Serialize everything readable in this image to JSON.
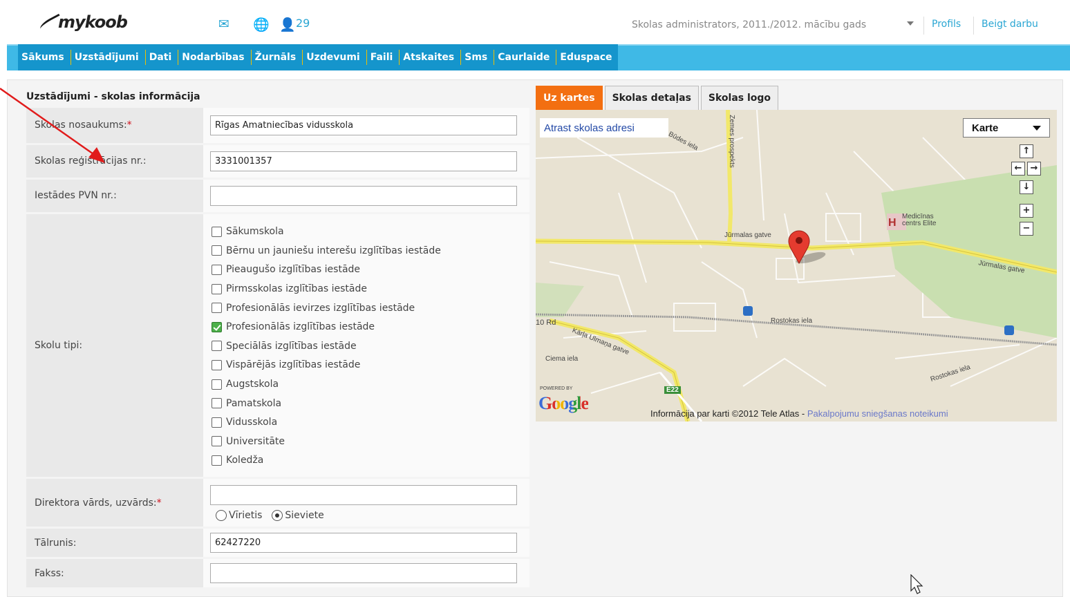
{
  "header": {
    "logo_text": "mykoob",
    "users_count": "29",
    "user_role": "Skolas administrators, 2011./2012. mācību gads",
    "profile_link": "Profils",
    "logout_link": "Beigt darbu"
  },
  "nav": {
    "items": [
      "Sākums",
      "Uzstādījumi",
      "Dati",
      "Nodarbības",
      "Žurnāls",
      "Uzdevumi",
      "Faili",
      "Atskaites",
      "Sms",
      "Caurlaide",
      "Eduspace"
    ],
    "active": "Uzstādījumi"
  },
  "form": {
    "title": "Uzstādījumi - skolas informācija",
    "fields": {
      "school_name": {
        "label": "Skolas nosaukums:",
        "value": "Rīgas Amatniecības vidusskola",
        "required": true
      },
      "registration": {
        "label": "Skolas reģistrācijas nr.:",
        "value": "3331001357"
      },
      "vat": {
        "label": "Iestādes PVN nr.:",
        "value": ""
      },
      "school_types": {
        "label": "Skolu tipi:",
        "options": [
          {
            "label": "Sākumskola",
            "checked": false
          },
          {
            "label": "Bērnu un jauniešu interešu izglītības iestāde",
            "checked": false
          },
          {
            "label": "Pieaugušo izglītības iestāde",
            "checked": false
          },
          {
            "label": "Pirmsskolas izglītības iestāde",
            "checked": false
          },
          {
            "label": "Profesionālās ievirzes izglītības iestāde",
            "checked": false
          },
          {
            "label": "Profesionālās izglītības iestāde",
            "checked": true
          },
          {
            "label": "Speciālās izglītības iestāde",
            "checked": false
          },
          {
            "label": "Vispārējās izglītības iestāde",
            "checked": false
          },
          {
            "label": "Augstskola",
            "checked": false
          },
          {
            "label": "Pamatskola",
            "checked": false
          },
          {
            "label": "Vidusskola",
            "checked": false
          },
          {
            "label": "Universitāte",
            "checked": false
          },
          {
            "label": "Koledža",
            "checked": false
          }
        ]
      },
      "director": {
        "label": "Direktora vārds, uzvārds:",
        "value": "",
        "required": true,
        "gender_male": "Vīrietis",
        "gender_female": "Sieviete",
        "gender_selected": "Sieviete"
      },
      "phone": {
        "label": "Tālrunis:",
        "value": "62427220"
      },
      "fax": {
        "label": "Fakss:",
        "value": ""
      }
    }
  },
  "tabs": {
    "items": [
      "Uz kartes",
      "Skolas detaļas",
      "Skolas logo"
    ],
    "active": "Uz kartes"
  },
  "map": {
    "find_address": "Atrast skolas adresi",
    "map_type": "Karte",
    "powered_by": "POWERED BY",
    "google": "Google",
    "attribution_text": "Informācija par karti ©2012 Tele Atlas - ",
    "terms_link": "Pakalpojumu sniegšanas noteikumi",
    "labels": {
      "jurmalas_gatve_1": "Jūrmalas gatve",
      "jurmalas_gatve_2": "Jūrmalas gatve",
      "zemes_prospekts": "Zemes prospekts",
      "rostokas_iela_1": "Rostokas iela",
      "rostokas_iela_2": "Rostokas iela",
      "karla_ulmana_gatve": "Kārļa Ulmaņa gatve",
      "ciema_iela": "Ciema iela",
      "medicinas_centrs": "Medicīnas centrs Elite",
      "road_10": "10 Rd",
      "e22": "E22",
      "budes_iela": "Būdes iela"
    },
    "controls": {
      "up": "↑",
      "left": "←",
      "right": "→",
      "down": "↓",
      "zoom_in": "+",
      "zoom_out": "−"
    },
    "hospital_marker": "H"
  },
  "colors": {
    "nav_bg": "#3fb9e6",
    "nav_active": "#1595cc",
    "tab_active": "#f36f11",
    "link": "#2aa6d3",
    "required": "#d0101a",
    "annotation_arrow": "#e11b1b"
  }
}
